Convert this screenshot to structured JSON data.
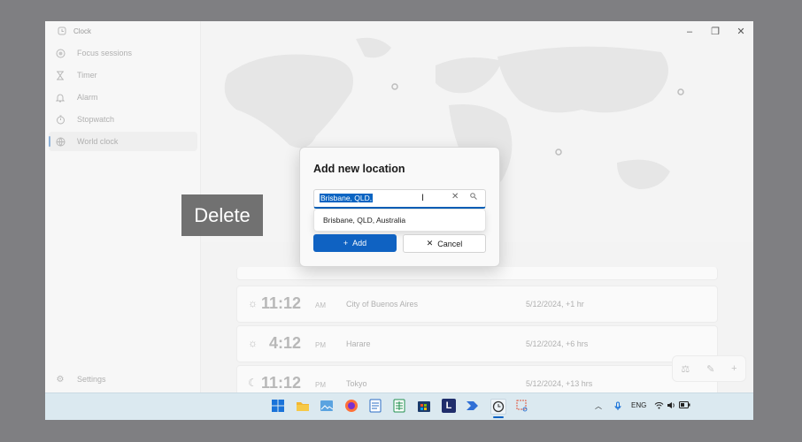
{
  "app": {
    "title": "Clock"
  },
  "sidebar": {
    "items": [
      {
        "label": "Focus sessions",
        "icon": "focus-icon"
      },
      {
        "label": "Timer",
        "icon": "hourglass-icon"
      },
      {
        "label": "Alarm",
        "icon": "bell-icon"
      },
      {
        "label": "Stopwatch",
        "icon": "stopwatch-icon"
      },
      {
        "label": "World clock",
        "icon": "globe-icon"
      }
    ],
    "settings_label": "Settings"
  },
  "window_controls": {
    "minimize": "–",
    "restore": "❐",
    "close": "✕"
  },
  "clocks": [
    {
      "time": "11:12",
      "ampm": "AM",
      "city": "City of Buenos Aires",
      "date": "5/12/2024, +1 hr",
      "icon": "sun-icon"
    },
    {
      "time": "4:12",
      "ampm": "PM",
      "city": "Harare",
      "date": "5/12/2024, +6 hrs",
      "icon": "sun-icon"
    },
    {
      "time": "11:12",
      "ampm": "PM",
      "city": "Tokyo",
      "date": "5/12/2024, +13 hrs",
      "icon": "moon-icon"
    }
  ],
  "dialog": {
    "title": "Add new location",
    "search_value": "Brisbane, QLD,",
    "suggestion": "Brisbane, QLD, Australia",
    "add_label": "Add",
    "cancel_label": "Cancel"
  },
  "overlay": {
    "text": "Delete"
  },
  "taskbar": {
    "language": "ENG"
  },
  "colors": {
    "accent": "#0f62c2",
    "taskbar": "#dbe9f0"
  }
}
